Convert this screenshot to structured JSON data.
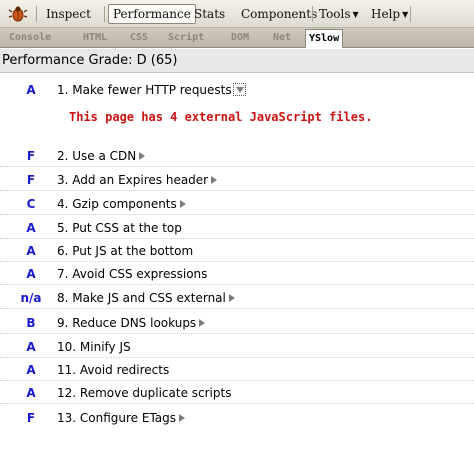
{
  "toolbar": {
    "items": [
      {
        "label": "Inspect"
      },
      {
        "label": "Performance"
      },
      {
        "label": "Stats"
      },
      {
        "label": "Components"
      },
      {
        "label": "Tools"
      },
      {
        "label": "Help"
      }
    ]
  },
  "subtabs": [
    {
      "label": "Console"
    },
    {
      "label": "HTML"
    },
    {
      "label": "CSS"
    },
    {
      "label": "Script"
    },
    {
      "label": "DOM"
    },
    {
      "label": "Net"
    },
    {
      "label": "YSlow"
    }
  ],
  "grade_header": "Performance Grade: D (65)",
  "rules": [
    {
      "grade": "A",
      "label": "1. Make fewer HTTP requests",
      "expanded": true,
      "detail": "This page has 4 external JavaScript files."
    },
    {
      "grade": "F",
      "label": "2. Use a CDN"
    },
    {
      "grade": "F",
      "label": "3. Add an Expires header"
    },
    {
      "grade": "C",
      "label": "4. Gzip components"
    },
    {
      "grade": "A",
      "label": "5. Put CSS at the top"
    },
    {
      "grade": "A",
      "label": "6. Put JS at the bottom"
    },
    {
      "grade": "A",
      "label": "7. Avoid CSS expressions"
    },
    {
      "grade": "n/a",
      "label": "8. Make JS and CSS external"
    },
    {
      "grade": "B",
      "label": "9. Reduce DNS lookups"
    },
    {
      "grade": "A",
      "label": "10. Minify JS"
    },
    {
      "grade": "A",
      "label": "11. Avoid redirects"
    },
    {
      "grade": "A",
      "label": "12. Remove duplicate scripts"
    },
    {
      "grade": "F",
      "label": "13. Configure ETags"
    }
  ],
  "colors": {
    "grade_text": "#1a1ad0",
    "detail_text": "#cc1111"
  },
  "icons": {
    "toolbar_logo": "firebug-icon",
    "expand": "expand-arrow-icon",
    "collapse": "collapse-arrow-icon"
  }
}
